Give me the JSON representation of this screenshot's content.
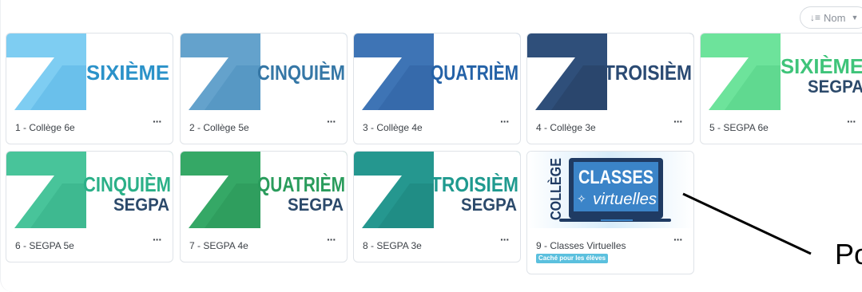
{
  "sort": {
    "label": "Nom"
  },
  "courses": [
    {
      "title": "1 - Collège 6e",
      "banner_word": "SIXIÈME",
      "banner_sub": "",
      "bg": "#7ecdf2",
      "band": "#5ab6e6",
      "word_color": "#2b92c9",
      "sub_color": ""
    },
    {
      "title": "2 - Collège 5e",
      "banner_word": "CINQUIÈM",
      "banner_sub": "",
      "bg": "#64a2cc",
      "band": "#4c8fbd",
      "word_color": "#3577a6",
      "sub_color": ""
    },
    {
      "title": "3 - Collège 4e",
      "banner_word": "QUATRIÈM",
      "banner_sub": "",
      "bg": "#3e74b5",
      "band": "#2f62a2",
      "word_color": "#2462a7",
      "sub_color": ""
    },
    {
      "title": "4 - Collège 3e",
      "banner_word": "TROISIÈM",
      "banner_sub": "",
      "bg": "#2f4f7a",
      "band": "#263f63",
      "word_color": "#2a4a73",
      "sub_color": ""
    },
    {
      "title": "5 - SEGPA 6e",
      "banner_word": "SIXIÈME",
      "banner_sub": "SEGPA",
      "bg": "#6de39b",
      "band": "#55d287",
      "word_color": "#3fc47a",
      "sub_color": "#2c4a6b"
    },
    {
      "title": "6 - SEGPA 5e",
      "banner_word": "CINQUIÈM",
      "banner_sub": "SEGPA",
      "bg": "#48c49a",
      "band": "#37b189",
      "word_color": "#2bb088",
      "sub_color": "#2c4a6b"
    },
    {
      "title": "7 - SEGPA 4e",
      "banner_word": "QUATRIÈM",
      "banner_sub": "SEGPA",
      "bg": "#35a866",
      "band": "#2a9557",
      "word_color": "#2a9c5c",
      "sub_color": "#2c4a6b"
    },
    {
      "title": "8 - SEGPA 3e",
      "banner_word": "TROISIÈM",
      "banner_sub": "SEGPA",
      "bg": "#25978f",
      "band": "#1d857e",
      "word_color": "#1f9a8f",
      "sub_color": "#2c4a6b"
    },
    {
      "title": "9 - Classes Virtuelles",
      "banner_word": "CLASSES",
      "banner_sub": "virtuelles",
      "side_word": "COLLÈGE",
      "badge": "Caché pour les élèves",
      "bg": "#d7ecfa",
      "band": "#1f3b63",
      "word_color": "#ffffff",
      "sub_color": "#ffffff"
    }
  ],
  "annotation": {
    "text": "Po"
  }
}
